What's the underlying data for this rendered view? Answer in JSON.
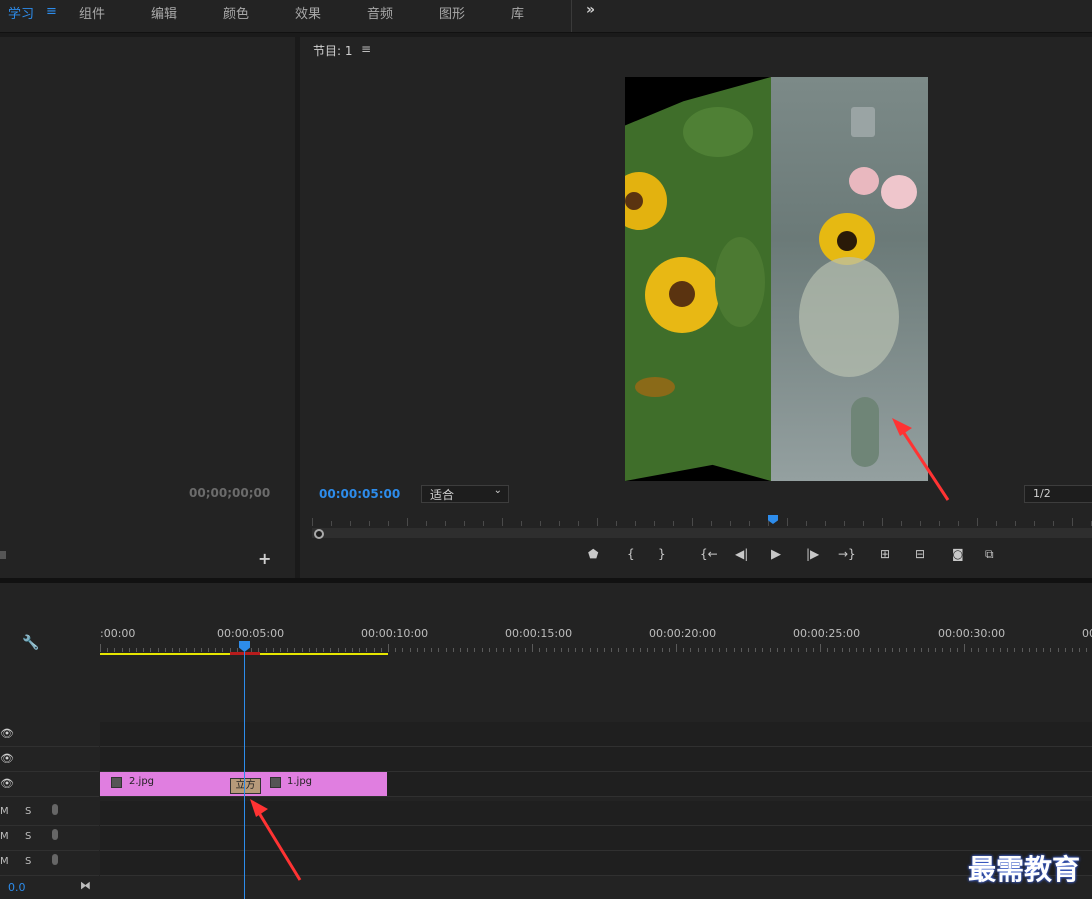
{
  "topbar": {
    "menus": [
      "学习",
      "组件",
      "编辑",
      "颜色",
      "效果",
      "音频",
      "图形",
      "库"
    ],
    "more_label": "»"
  },
  "left_panel": {
    "timecode": "00;00;00;00",
    "add_label": "+"
  },
  "program": {
    "title": "节目: 1",
    "menu_label": "≡",
    "timecode": "00:00:05:00",
    "fit": "适合",
    "resolution": "1/2"
  },
  "timeline": {
    "ruler_labels": [
      ":00:00",
      "00:00:05:00",
      "00:00:10:00",
      "00:00:15:00",
      "00:00:20:00",
      "00:00:25:00",
      "00:00:30:00",
      "00"
    ],
    "clips": [
      "2.jpg",
      "1.jpg"
    ],
    "transition_label": "立方",
    "zoom_value": "0.0",
    "track_labels": {
      "m": "M",
      "s": "S"
    }
  },
  "watermark": "最需教育",
  "colors": {
    "accent": "#2d8ceb",
    "clip": "#e07ee0",
    "arrow": "#ff3333"
  }
}
